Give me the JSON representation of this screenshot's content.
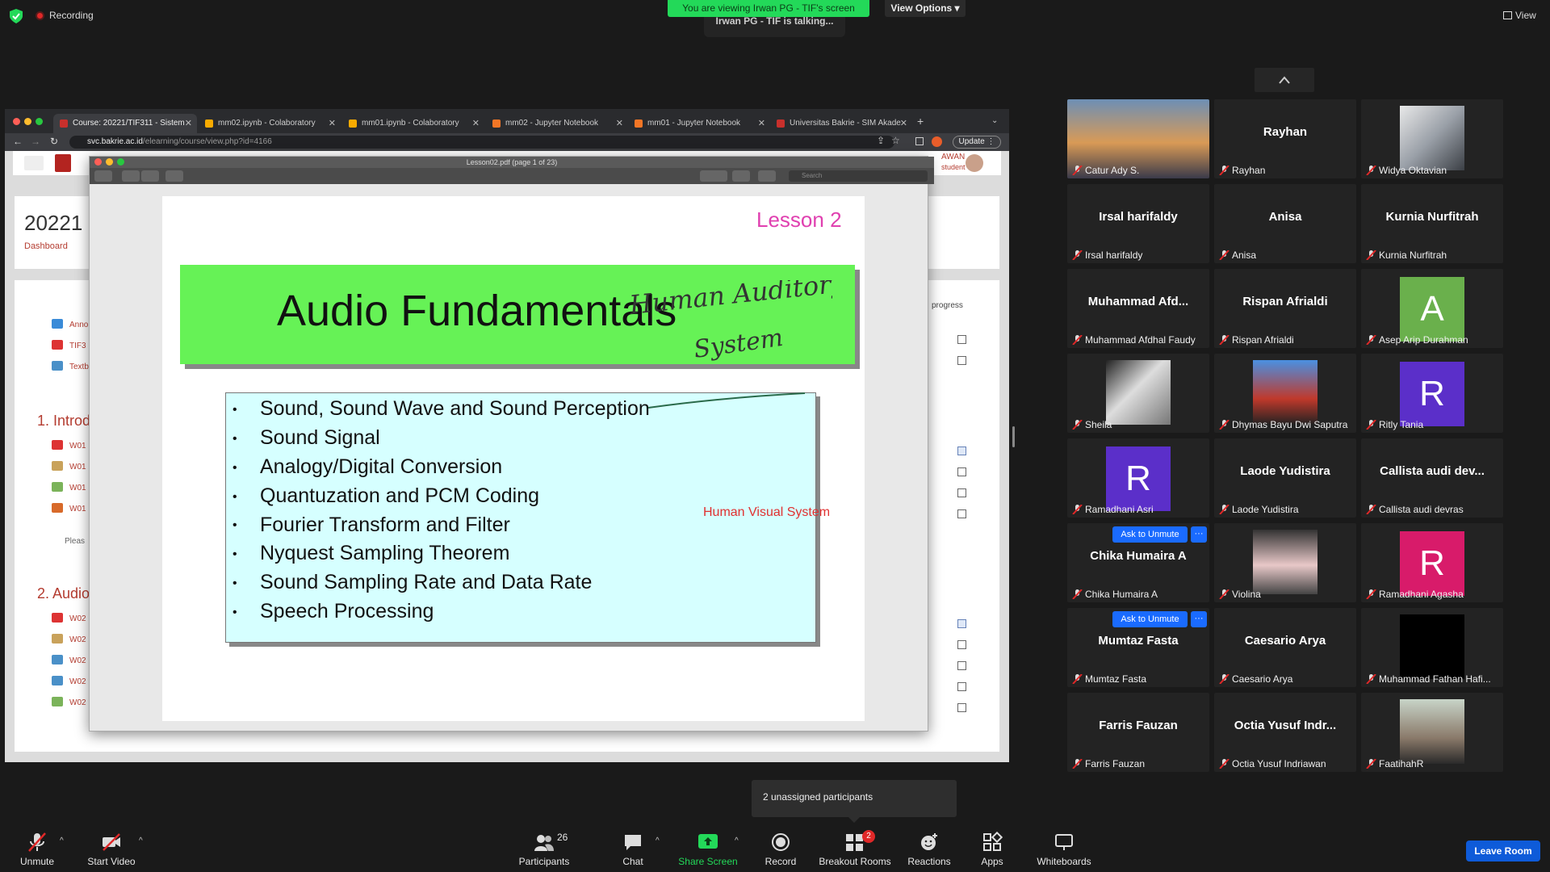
{
  "top": {
    "recording": "Recording",
    "viewing_banner": "You are viewing Irwan PG - TIF's screen",
    "view_options": "View Options",
    "talking": "Irwan PG - TIF is talking...",
    "view": "View"
  },
  "browser": {
    "tabs": [
      {
        "label": "Course: 20221/TIF311 - Sistem",
        "color": "#c8302c"
      },
      {
        "label": "mm02.ipynb - Colaboratory",
        "color": "#f9ab00"
      },
      {
        "label": "mm01.ipynb - Colaboratory",
        "color": "#f9ab00"
      },
      {
        "label": "mm02 - Jupyter Notebook",
        "color": "#f37626"
      },
      {
        "label": "mm01 - Jupyter Notebook",
        "color": "#f37626"
      },
      {
        "label": "Universitas Bakrie - SIM Akade",
        "color": "#c8302c"
      }
    ],
    "url_host": "svc.bakrie.ac.id",
    "url_path": "/elearning/course/view.php?id=4166",
    "update": "Update"
  },
  "moodle": {
    "user_short": "AWAN",
    "role": "student",
    "course_title": "20221",
    "breadcrumb": "Dashboard",
    "progress": "progress",
    "top_items": [
      "Anno",
      "TIF3",
      "Textb"
    ],
    "section1": "1. Introd",
    "section1_items": [
      "W01",
      "W01",
      "W01",
      "W01"
    ],
    "please": "Pleas",
    "section2": "2. Audio",
    "section2_items": [
      "W02",
      "W02",
      "W02",
      "W02",
      "W02"
    ]
  },
  "pdf": {
    "title": "Lesson02.pdf (page 1 of 23)",
    "search_placeholder": "Search",
    "lesson": "Lesson 2",
    "heading": "Audio Fundamentals",
    "bullets": [
      "Sound, Sound Wave and Sound Perception",
      "Sound Signal",
      "Analogy/Digital Conversion",
      "Quantuzation and PCM Coding",
      "Fourier Transform and Filter",
      "Nyquest Sampling Theorem",
      "Sound Sampling Rate and Data Rate",
      "Speech Processing"
    ],
    "handwriting": "Human Auditory System",
    "annotation": "Human Visual System"
  },
  "participants": [
    {
      "big": "",
      "name": "Catur Ady S."
    },
    {
      "big": "Rayhan",
      "name": "Rayhan"
    },
    {
      "big": "",
      "name": "Widya Oktavian"
    },
    {
      "big": "Irsal harifaldy",
      "name": "Irsal harifaldy"
    },
    {
      "big": "Anisa",
      "name": "Anisa"
    },
    {
      "big": "Kurnia Nurfitrah",
      "name": "Kurnia Nurfitrah"
    },
    {
      "big": "Muhammad Afd...",
      "name": "Muhammad Afdhal Faudy"
    },
    {
      "big": "Rispan Afrialdi",
      "name": "Rispan Afrialdi"
    },
    {
      "big": "A",
      "name": "Asep Arip Durahman"
    },
    {
      "big": "",
      "name": "Sheila"
    },
    {
      "big": "",
      "name": "Dhymas Bayu Dwi Saputra"
    },
    {
      "big": "R",
      "name": "Ritly Tania"
    },
    {
      "big": "R",
      "name": "Ramadhani Asri"
    },
    {
      "big": "Laode Yudistira",
      "name": "Laode Yudistira"
    },
    {
      "big": "Callista audi dev...",
      "name": "Callista audi devras"
    },
    {
      "big": "Chika Humaira A",
      "name": "Chika Humaira A"
    },
    {
      "big": "",
      "name": "Violina"
    },
    {
      "big": "R",
      "name": "Ramadhani Agasha"
    },
    {
      "big": "Mumtaz Fasta",
      "name": "Mumtaz Fasta"
    },
    {
      "big": "Caesario Arya",
      "name": "Caesario Arya"
    },
    {
      "big": "",
      "name": "Muhammad Fathan Hafi..."
    },
    {
      "big": "Farris Fauzan",
      "name": "Farris Fauzan"
    },
    {
      "big": "Octia Yusuf Indr...",
      "name": "Octia Yusuf Indriawan"
    },
    {
      "big": "",
      "name": "FaatihahR"
    }
  ],
  "ask_to_unmute": "Ask to Unmute",
  "more": "···",
  "tooltip": "2 unassigned participants",
  "toolbar": {
    "unmute": "Unmute",
    "start_video": "Start Video",
    "participants": "Participants",
    "participants_count": "26",
    "chat": "Chat",
    "share": "Share Screen",
    "record": "Record",
    "breakout": "Breakout Rooms",
    "breakout_badge": "2",
    "reactions": "Reactions",
    "apps": "Apps",
    "whiteboards": "Whiteboards",
    "leave": "Leave Room"
  },
  "colors": {
    "avatar_green": "#6ab04c",
    "avatar_purple": "#5b2fc9",
    "avatar_pink": "#d81b6a",
    "zoom_green": "#23d959",
    "zoom_blue": "#0e5bd9"
  }
}
